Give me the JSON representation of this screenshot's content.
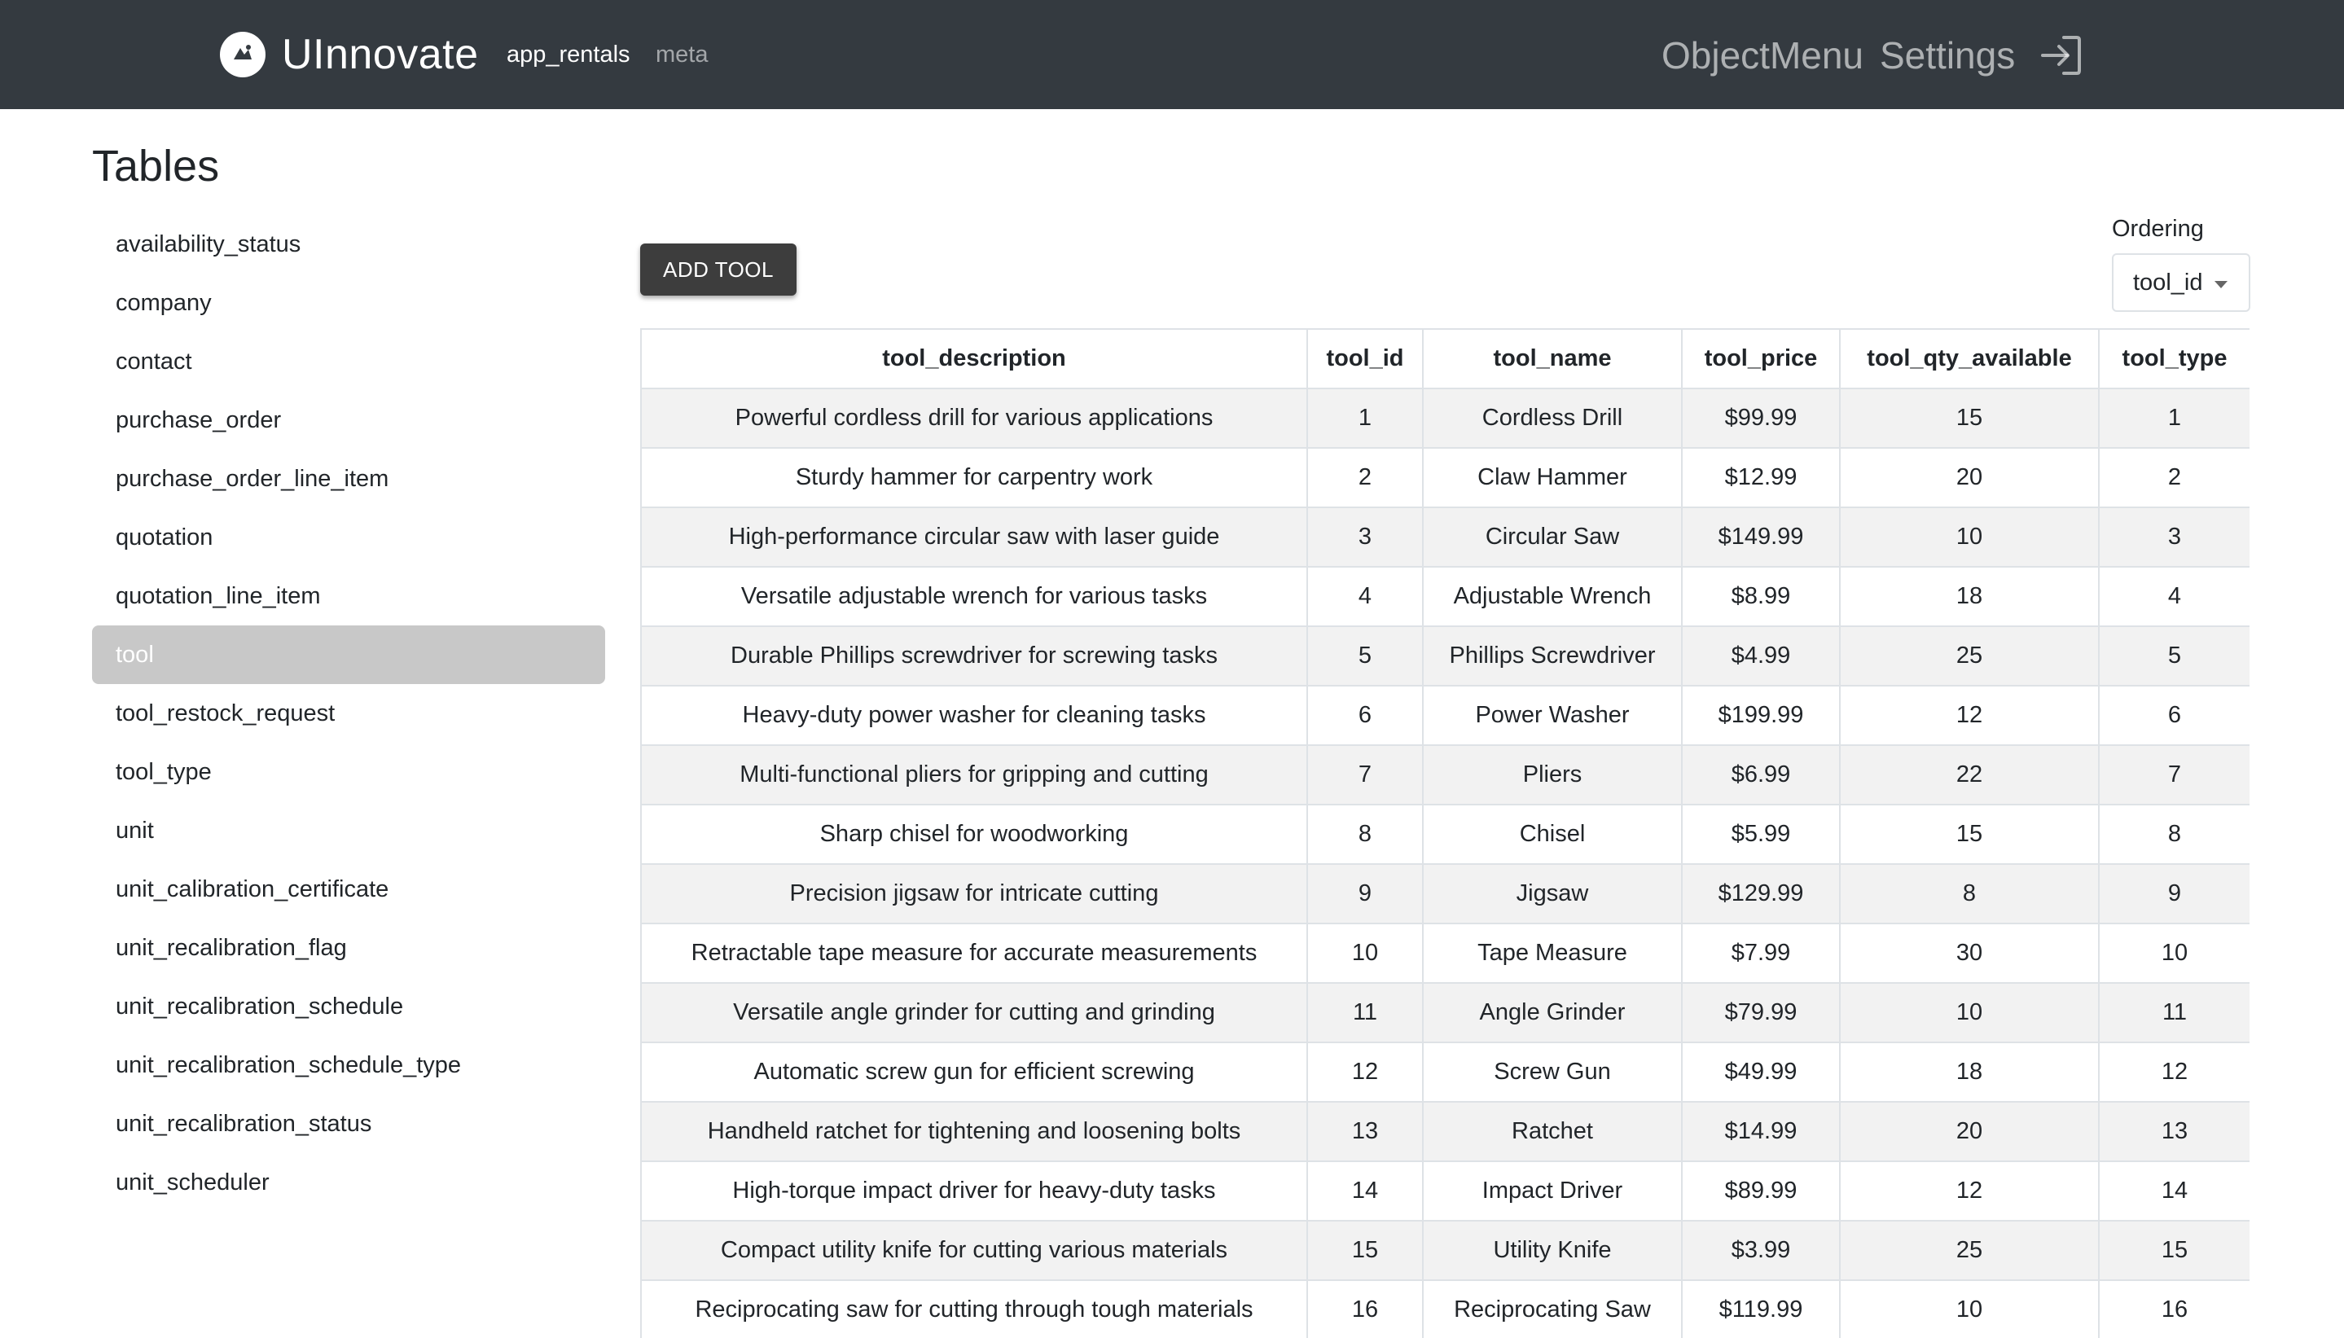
{
  "navbar": {
    "brand": "UInnovate",
    "links": [
      "app_rentals",
      "meta"
    ],
    "right_links": [
      "ObjectMenu",
      "Settings"
    ],
    "logout_icon": "logout-icon"
  },
  "sidebar": {
    "title": "Tables",
    "items": [
      {
        "label": "availability_status"
      },
      {
        "label": "company"
      },
      {
        "label": "contact"
      },
      {
        "label": "purchase_order"
      },
      {
        "label": "purchase_order_line_item"
      },
      {
        "label": "quotation"
      },
      {
        "label": "quotation_line_item"
      },
      {
        "label": "tool",
        "active": true
      },
      {
        "label": "tool_restock_request"
      },
      {
        "label": "tool_type"
      },
      {
        "label": "unit"
      },
      {
        "label": "unit_calibration_certificate"
      },
      {
        "label": "unit_recalibration_flag"
      },
      {
        "label": "unit_recalibration_schedule"
      },
      {
        "label": "unit_recalibration_schedule_type"
      },
      {
        "label": "unit_recalibration_status"
      },
      {
        "label": "unit_scheduler"
      }
    ]
  },
  "main": {
    "add_button_label": "ADD TOOL",
    "ordering": {
      "label": "Ordering",
      "selected": "tool_id"
    },
    "table": {
      "columns": [
        "tool_description",
        "tool_id",
        "tool_name",
        "tool_price",
        "tool_qty_available",
        "tool_type"
      ],
      "rows": [
        [
          "Powerful cordless drill for various applications",
          "1",
          "Cordless Drill",
          "$99.99",
          "15",
          "1"
        ],
        [
          "Sturdy hammer for carpentry work",
          "2",
          "Claw Hammer",
          "$12.99",
          "20",
          "2"
        ],
        [
          "High-performance circular saw with laser guide",
          "3",
          "Circular Saw",
          "$149.99",
          "10",
          "3"
        ],
        [
          "Versatile adjustable wrench for various tasks",
          "4",
          "Adjustable Wrench",
          "$8.99",
          "18",
          "4"
        ],
        [
          "Durable Phillips screwdriver for screwing tasks",
          "5",
          "Phillips Screwdriver",
          "$4.99",
          "25",
          "5"
        ],
        [
          "Heavy-duty power washer for cleaning tasks",
          "6",
          "Power Washer",
          "$199.99",
          "12",
          "6"
        ],
        [
          "Multi-functional pliers for gripping and cutting",
          "7",
          "Pliers",
          "$6.99",
          "22",
          "7"
        ],
        [
          "Sharp chisel for woodworking",
          "8",
          "Chisel",
          "$5.99",
          "15",
          "8"
        ],
        [
          "Precision jigsaw for intricate cutting",
          "9",
          "Jigsaw",
          "$129.99",
          "8",
          "9"
        ],
        [
          "Retractable tape measure for accurate measurements",
          "10",
          "Tape Measure",
          "$7.99",
          "30",
          "10"
        ],
        [
          "Versatile angle grinder for cutting and grinding",
          "11",
          "Angle Grinder",
          "$79.99",
          "10",
          "11"
        ],
        [
          "Automatic screw gun for efficient screwing",
          "12",
          "Screw Gun",
          "$49.99",
          "18",
          "12"
        ],
        [
          "Handheld ratchet for tightening and loosening bolts",
          "13",
          "Ratchet",
          "$14.99",
          "20",
          "13"
        ],
        [
          "High-torque impact driver for heavy-duty tasks",
          "14",
          "Impact Driver",
          "$89.99",
          "12",
          "14"
        ],
        [
          "Compact utility knife for cutting various materials",
          "15",
          "Utility Knife",
          "$3.99",
          "25",
          "15"
        ],
        [
          "Reciprocating saw for cutting through tough materials",
          "16",
          "Reciprocating Saw",
          "$119.99",
          "10",
          "16"
        ]
      ]
    }
  }
}
